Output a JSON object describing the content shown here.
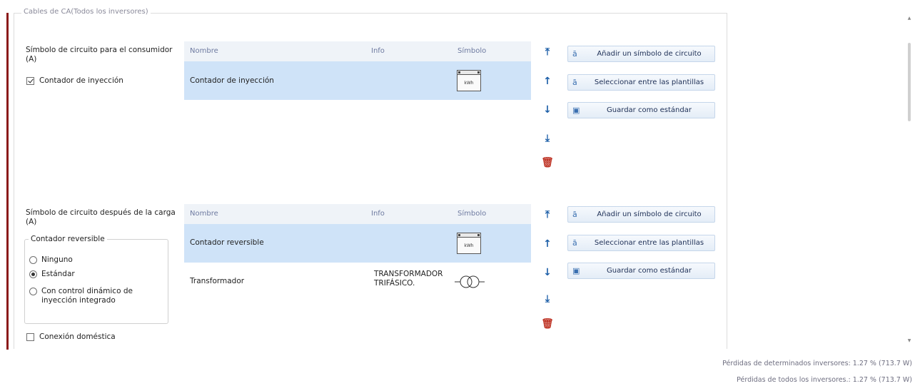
{
  "section_title": "Cables de CA(Todos los inversores)",
  "consumer": {
    "label": "Símbolo de circuito para el consumidor (A)",
    "checkbox_label": "Contador de inyección",
    "checkbox_checked": true,
    "columns": {
      "name": "Nombre",
      "info": "Info",
      "symbol": "Símbolo"
    },
    "rows": [
      {
        "name": "Contador de inyección",
        "info": "",
        "symbol": "meter-icon",
        "symbol_text": "kWh",
        "selected": true
      }
    ]
  },
  "load": {
    "label": "Símbolo de circuito después de la carga (A)",
    "group_title": "Contador reversible",
    "radio_options": [
      {
        "label": "Ninguno",
        "checked": false
      },
      {
        "label": "Estándar",
        "checked": true
      },
      {
        "label": "Con control dinámico de inyección integrado",
        "checked": false
      }
    ],
    "checkbox_label": "Conexión doméstica",
    "checkbox_checked": false,
    "columns": {
      "name": "Nombre",
      "info": "Info",
      "symbol": "Símbolo"
    },
    "rows": [
      {
        "name": "Contador reversible",
        "info": "",
        "symbol": "meter-icon",
        "symbol_text": "kWh",
        "selected": true
      },
      {
        "name": "Transformador",
        "info": "TRANSFORMADOR TRIFÁSICO.",
        "symbol": "transformer-icon",
        "selected": false
      }
    ]
  },
  "arrow_icons": [
    "move-top-icon",
    "move-up-icon",
    "move-down-icon",
    "move-bottom-icon",
    "delete-icon"
  ],
  "buttons": {
    "add_symbol": "Añadir un símbolo de circuito",
    "select_template": "Seleccionar entre las plantillas",
    "save_standard": "Guardar como estándar"
  },
  "footer": {
    "losses_selected": "Pérdidas de determinados inversores: 1.27 % (713.7 W)",
    "losses_all": "Pérdidas de todos los inversores.: 1.27 % (713.7 W)"
  },
  "colors": {
    "accent_bar": "#8b1a1a",
    "selected_row": "#cfe3f8",
    "header_row": "#eff3f8",
    "arrow_blue": "#1d5fa8",
    "delete_red": "#c0392b"
  }
}
